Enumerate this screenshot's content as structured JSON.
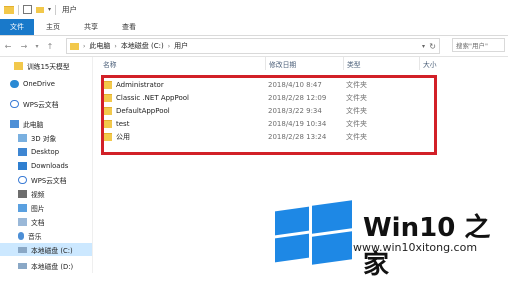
{
  "window": {
    "title": "用户"
  },
  "ribbon": {
    "tabs": [
      "文件",
      "主页",
      "共享",
      "查看"
    ]
  },
  "address": {
    "crumbs": [
      "此电脑",
      "本地磁盘 (C:)",
      "用户"
    ]
  },
  "search": {
    "placeholder": "搜索\"用户\""
  },
  "sidebar": {
    "items": [
      {
        "label": "训练15天模型",
        "icon": "folder-icon"
      },
      {
        "label": "OneDrive",
        "icon": "cloud-icon"
      },
      {
        "label": "WPS云文档",
        "icon": "wps-cloud-icon"
      },
      {
        "label": "此电脑",
        "icon": "computer-icon"
      },
      {
        "label": "3D 对象",
        "icon": "cube-icon"
      },
      {
        "label": "Desktop",
        "icon": "desktop-icon"
      },
      {
        "label": "Downloads",
        "icon": "download-icon"
      },
      {
        "label": "WPS云文档",
        "icon": "wps-cloud-icon"
      },
      {
        "label": "视频",
        "icon": "video-icon"
      },
      {
        "label": "图片",
        "icon": "picture-icon"
      },
      {
        "label": "文档",
        "icon": "document-icon"
      },
      {
        "label": "音乐",
        "icon": "music-icon"
      },
      {
        "label": "本地磁盘 (C:)",
        "icon": "drive-icon"
      },
      {
        "label": "本地磁盘 (D:)",
        "icon": "drive-icon"
      }
    ]
  },
  "columns": {
    "name": "名称",
    "date": "修改日期",
    "type": "类型",
    "size": "大小"
  },
  "files": [
    {
      "name": "Administrator",
      "date": "2018/4/10 8:47",
      "type": "文件夹"
    },
    {
      "name": "Classic .NET AppPool",
      "date": "2018/2/28 12:09",
      "type": "文件夹"
    },
    {
      "name": "DefaultAppPool",
      "date": "2018/3/22 9:34",
      "type": "文件夹"
    },
    {
      "name": "test",
      "date": "2018/4/19 10:34",
      "type": "文件夹"
    },
    {
      "name": "公用",
      "date": "2018/2/28 13:24",
      "type": "文件夹"
    }
  ],
  "watermark": {
    "brand": "Win10 之家",
    "url": "www.win10xitong.com"
  },
  "colors": {
    "accent": "#1979ca",
    "highlight": "#d22028",
    "folder": "#f2c84b",
    "logo": "#1e88e5"
  }
}
